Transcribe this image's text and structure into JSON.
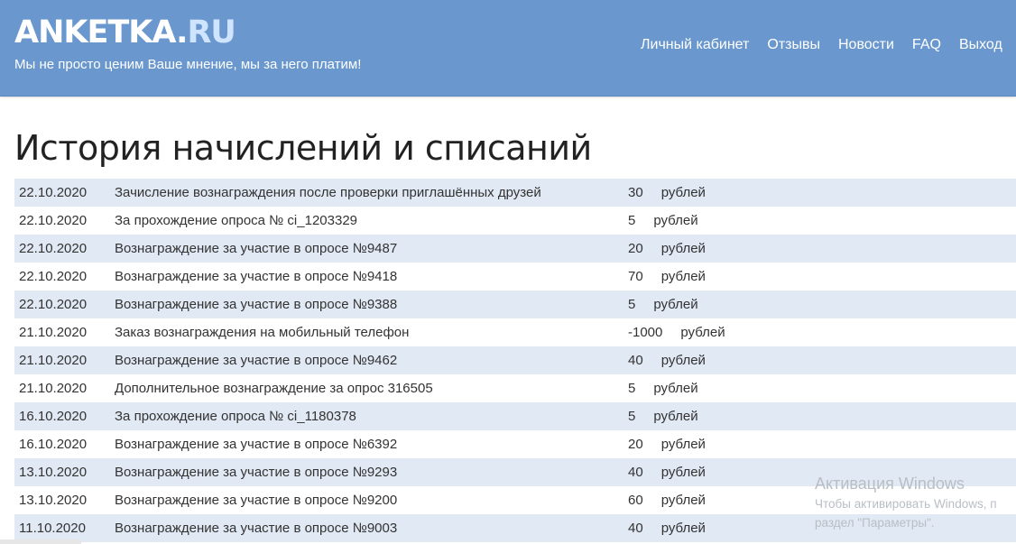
{
  "header": {
    "logo_main": "ANKETKA.",
    "logo_tld": "RU",
    "tagline": "Мы не просто ценим Ваше мнение, мы за него платим!",
    "nav": [
      {
        "label": "Личный кабинет",
        "icon": ""
      },
      {
        "label": "Отзывы"
      },
      {
        "label": "Новости"
      },
      {
        "label": "FAQ"
      },
      {
        "label": "Выход"
      }
    ]
  },
  "main": {
    "title": "История начислений и списаний",
    "rows": [
      {
        "date": "22.10.2020",
        "description": "Зачисление вознаграждения после проверки приглашённых друзей",
        "amount": "30",
        "currency": "рублей"
      },
      {
        "date": "22.10.2020",
        "description": "За прохождение опроса № ci_1203329",
        "amount": "5",
        "currency": "рублей"
      },
      {
        "date": "22.10.2020",
        "description": "Вознаграждение за участие в опросе №9487",
        "amount": "20",
        "currency": "рублей"
      },
      {
        "date": "22.10.2020",
        "description": "Вознаграждение за участие в опросе №9418",
        "amount": "70",
        "currency": "рублей"
      },
      {
        "date": "22.10.2020",
        "description": "Вознаграждение за участие в опросе №9388",
        "amount": "5",
        "currency": "рублей"
      },
      {
        "date": "21.10.2020",
        "description": "Заказ вознаграждения на мобильный телефон",
        "amount": "-1000",
        "currency": "рублей"
      },
      {
        "date": "21.10.2020",
        "description": "Вознаграждение за участие в опросе №9462",
        "amount": "40",
        "currency": "рублей"
      },
      {
        "date": "21.10.2020",
        "description": "Дополнительное вознаграждение за опрос 316505",
        "amount": "5",
        "currency": "рублей"
      },
      {
        "date": "16.10.2020",
        "description": "За прохождение опроса № ci_1180378",
        "amount": "5",
        "currency": "рублей"
      },
      {
        "date": "16.10.2020",
        "description": "Вознаграждение за участие в опросе №6392",
        "amount": "20",
        "currency": "рублей"
      },
      {
        "date": "13.10.2020",
        "description": "Вознаграждение за участие в опросе №9293",
        "amount": "40",
        "currency": "рублей"
      },
      {
        "date": "13.10.2020",
        "description": "Вознаграждение за участие в опросе №9200",
        "amount": "60",
        "currency": "рублей"
      },
      {
        "date": "11.10.2020",
        "description": "Вознаграждение за участие в опросе №9003",
        "amount": "40",
        "currency": "рублей"
      }
    ]
  },
  "watermark": {
    "title": "Активация Windows",
    "line1": "Чтобы активировать Windows, п",
    "line2": "раздел \"Параметры\"."
  },
  "colors": {
    "header_bg": "#6a98ce",
    "row_stripe": "#e1e9f4",
    "logo_tld": "#cfe4ff"
  }
}
